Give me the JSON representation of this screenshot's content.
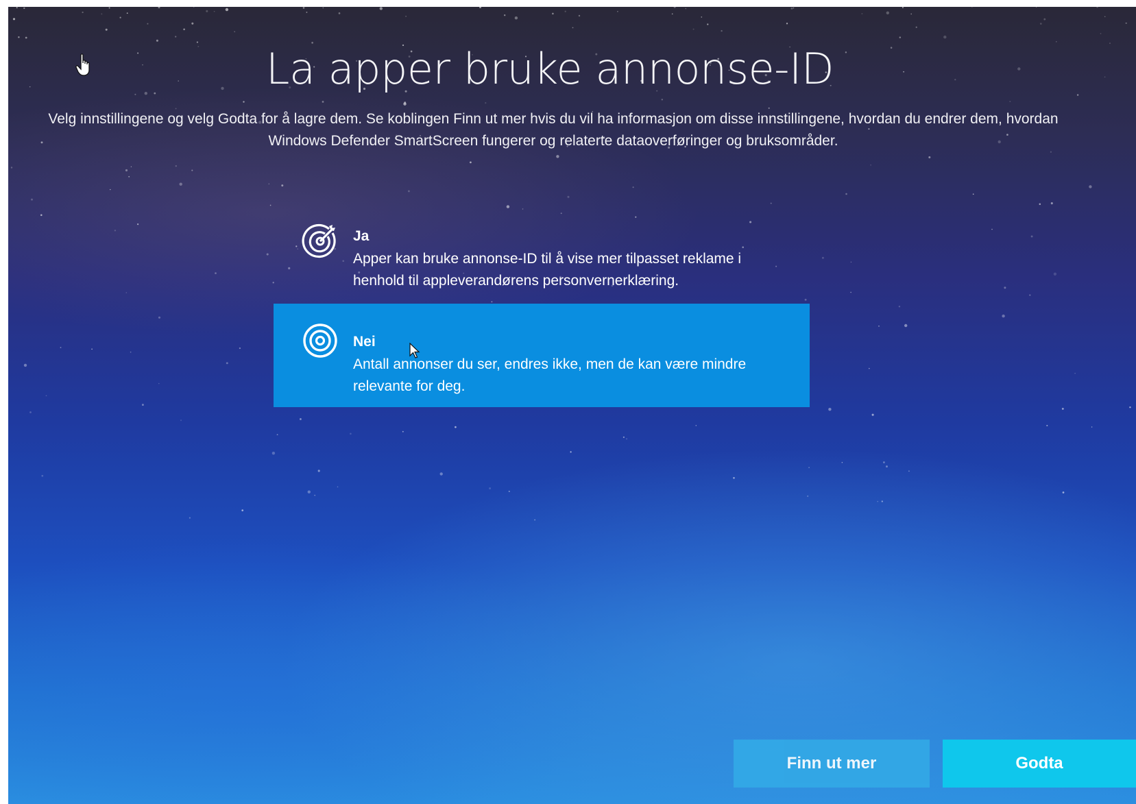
{
  "page": {
    "title": "La apper bruke annonse-ID",
    "description": "Velg innstillingene og velg Godta for å lagre dem. Se koblingen Finn ut mer hvis du vil ha informasjon om disse innstillingene, hvordan du endrer dem, hvordan Windows Defender SmartScreen fungerer og relaterte dataoverføringer og bruksområder."
  },
  "options": [
    {
      "title": "Ja",
      "description": "Apper kan bruke annonse-ID til å vise mer tilpasset reklame i henhold til appleverandørens personvernerklæring.",
      "selected": false,
      "icon": "target-with-arrow-icon"
    },
    {
      "title": "Nei",
      "description": "Antall annonser du ser, endres ikke, men de kan være mindre relevante for deg.",
      "selected": true,
      "icon": "target-icon"
    }
  ],
  "buttons": {
    "learn_more": "Finn ut mer",
    "accept": "Godta"
  },
  "colors": {
    "selected_option": "#0a8ee0",
    "accept_button": "#0fc7ec",
    "learn_more_button": "#33a9e6",
    "text": "#ffffff"
  }
}
